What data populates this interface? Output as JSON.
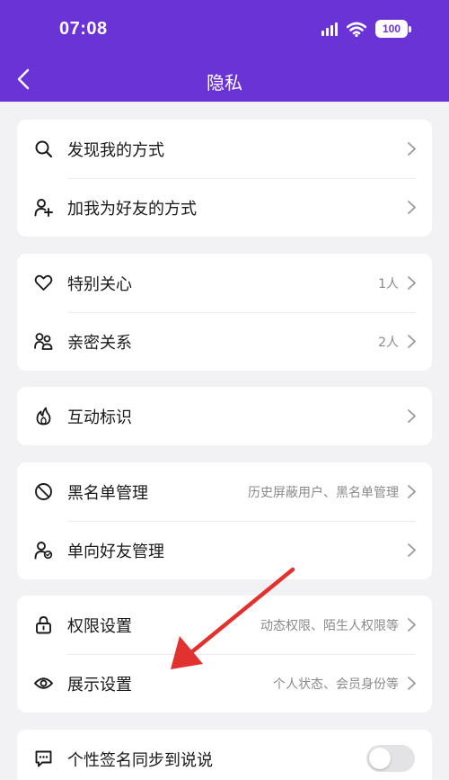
{
  "status_bar": {
    "time": "07:08",
    "battery": "100"
  },
  "nav": {
    "title": "隐私"
  },
  "groups": [
    {
      "items": [
        {
          "icon": "search-icon",
          "label": "发现我的方式",
          "value": ""
        },
        {
          "icon": "add-person-icon",
          "label": "加我为好友的方式",
          "value": ""
        }
      ]
    },
    {
      "items": [
        {
          "icon": "heart-icon",
          "label": "特别关心",
          "value": "1人"
        },
        {
          "icon": "people-icon",
          "label": "亲密关系",
          "value": "2人"
        }
      ]
    },
    {
      "items": [
        {
          "icon": "flame-icon",
          "label": "互动标识",
          "value": ""
        }
      ]
    },
    {
      "items": [
        {
          "icon": "block-icon",
          "label": "黑名单管理",
          "value": "历史屏蔽用户、黑名单管理"
        },
        {
          "icon": "person-settings-icon",
          "label": "单向好友管理",
          "value": ""
        }
      ]
    },
    {
      "items": [
        {
          "icon": "lock-icon",
          "label": "权限设置",
          "value": "动态权限、陌生人权限等"
        },
        {
          "icon": "eye-icon",
          "label": "展示设置",
          "value": "个人状态、会员身份等"
        }
      ]
    },
    {
      "items": [
        {
          "icon": "chat-bubble-icon",
          "label": "个性签名同步到说说",
          "toggle": false
        }
      ]
    }
  ],
  "colors": {
    "header": "#6a33d6",
    "annotation_arrow": "#e1322f",
    "toggle_off": "#e3e3e6"
  }
}
